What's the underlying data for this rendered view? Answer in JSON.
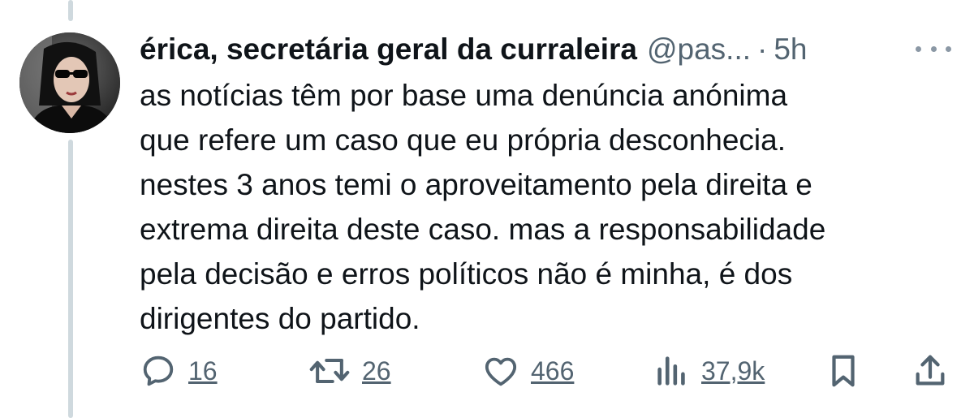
{
  "tweet": {
    "author_name": "érica, secretária geral da curraleira",
    "handle": "@pas...",
    "separator": "·",
    "time": "5h",
    "text_lines": [
      "as notícias têm por base uma denúncia anónima",
      "que refere um caso que eu própria desconhecia.",
      "nestes 3 anos temi o aproveitamento pela direita e",
      "extrema direita deste caso. mas a responsabilidade",
      "pela decisão e erros políticos não é minha, é dos",
      "dirigentes do partido."
    ]
  },
  "actions": {
    "replies": "16",
    "retweets": "26",
    "likes": "466",
    "views": "37,9k"
  },
  "icons": {
    "reply": "reply-icon",
    "retweet": "retweet-icon",
    "like": "heart-icon",
    "views": "views-icon",
    "bookmark": "bookmark-icon",
    "share": "share-icon",
    "more": "more-icon"
  },
  "colors": {
    "text": "#0f1419",
    "secondary": "#536471",
    "thread_line": "#cfd9de"
  }
}
